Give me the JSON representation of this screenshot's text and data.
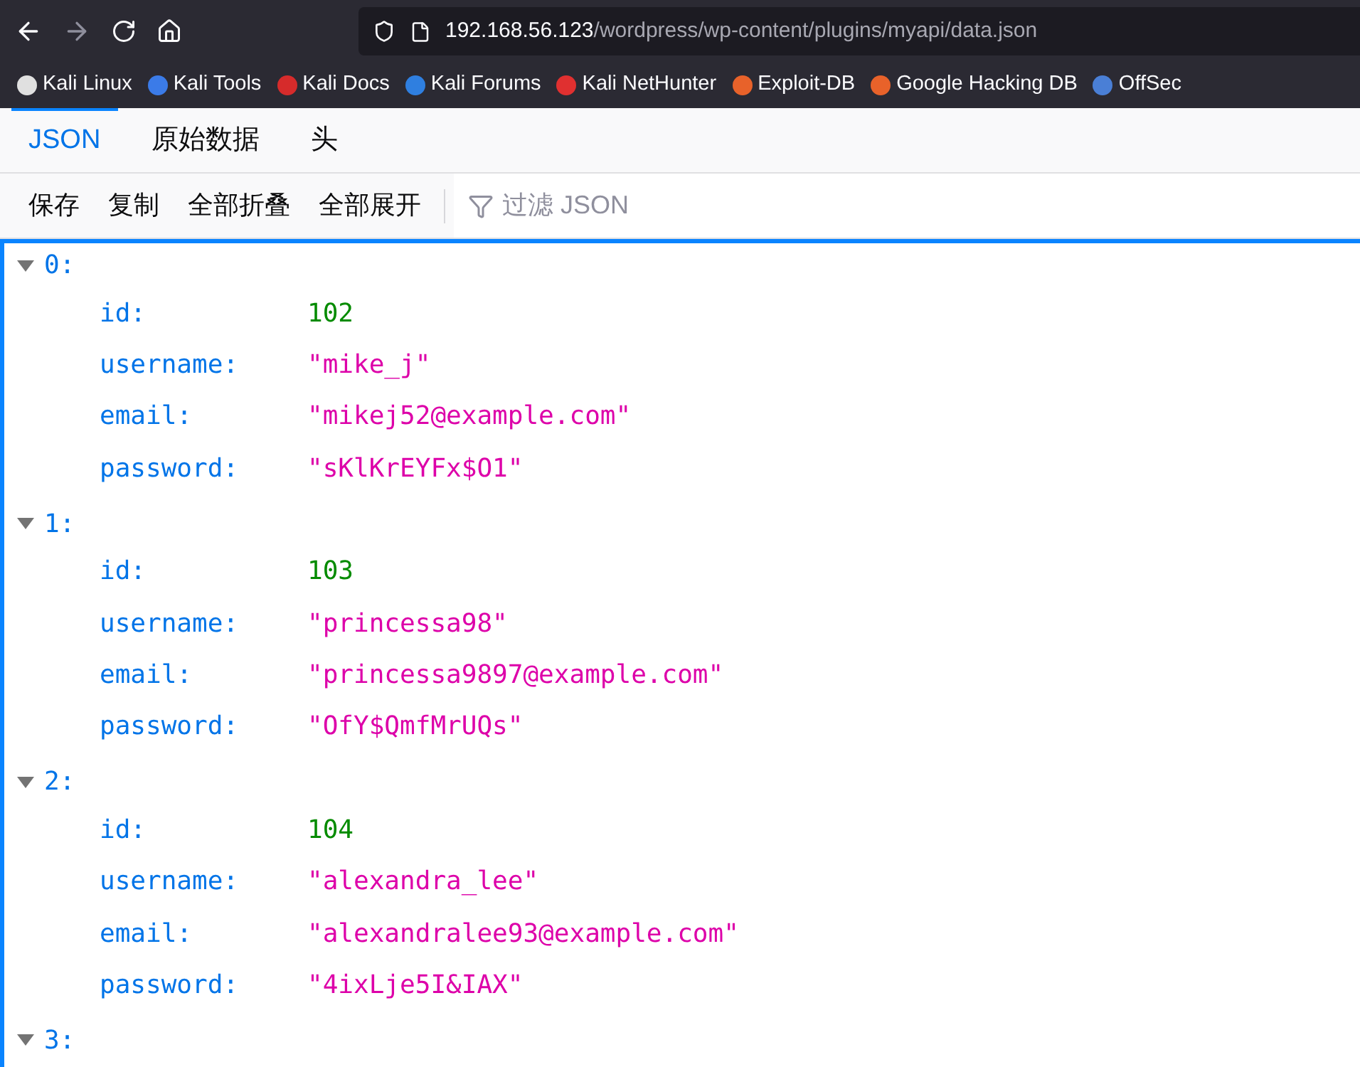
{
  "url": {
    "host": "192.168.56.123",
    "path": "/wordpress/wp-content/plugins/myapi/data.json"
  },
  "bookmarks": [
    {
      "label": "Kali Linux",
      "color": "#e0e0e0"
    },
    {
      "label": "Kali Tools",
      "color": "#3b7be8"
    },
    {
      "label": "Kali Docs",
      "color": "#d62b2b"
    },
    {
      "label": "Kali Forums",
      "color": "#2f7fe0"
    },
    {
      "label": "Kali NetHunter",
      "color": "#e03030"
    },
    {
      "label": "Exploit-DB",
      "color": "#e8622a"
    },
    {
      "label": "Google Hacking DB",
      "color": "#e8622a"
    },
    {
      "label": "OffSec",
      "color": "#4a7fd6"
    }
  ],
  "tabs": [
    {
      "label": "JSON",
      "selected": true
    },
    {
      "label": "原始数据",
      "selected": false
    },
    {
      "label": "头",
      "selected": false
    }
  ],
  "toolbar": [
    "保存",
    "复制",
    "全部折叠",
    "全部展开"
  ],
  "filter": {
    "placeholder": "过滤 JSON"
  },
  "items": [
    {
      "key": "0:",
      "expanded": true,
      "fields": [
        {
          "key": "id:",
          "value": "102",
          "kind": "number"
        },
        {
          "key": "username:",
          "value": "\"mike_j\"",
          "kind": "string"
        },
        {
          "key": "email:",
          "value": "\"mikej52@example.com\"",
          "kind": "string"
        },
        {
          "key": "password:",
          "value": "\"sKlKrEYFx$O1\"",
          "kind": "string"
        }
      ]
    },
    {
      "key": "1:",
      "expanded": true,
      "fields": [
        {
          "key": "id:",
          "value": "103",
          "kind": "number"
        },
        {
          "key": "username:",
          "value": "\"princessa98\"",
          "kind": "string"
        },
        {
          "key": "email:",
          "value": "\"princessa9897@example.com\"",
          "kind": "string"
        },
        {
          "key": "password:",
          "value": "\"OfY$QmfMrUQs\"",
          "kind": "string"
        }
      ]
    },
    {
      "key": "2:",
      "expanded": true,
      "fields": [
        {
          "key": "id:",
          "value": "104",
          "kind": "number"
        },
        {
          "key": "username:",
          "value": "\"alexandra_lee\"",
          "kind": "string"
        },
        {
          "key": "email:",
          "value": "\"alexandralee93@example.com\"",
          "kind": "string"
        },
        {
          "key": "password:",
          "value": "\"4ixLje5I&IAX\"",
          "kind": "string"
        }
      ]
    },
    {
      "key": "3:",
      "expanded": true
    }
  ]
}
